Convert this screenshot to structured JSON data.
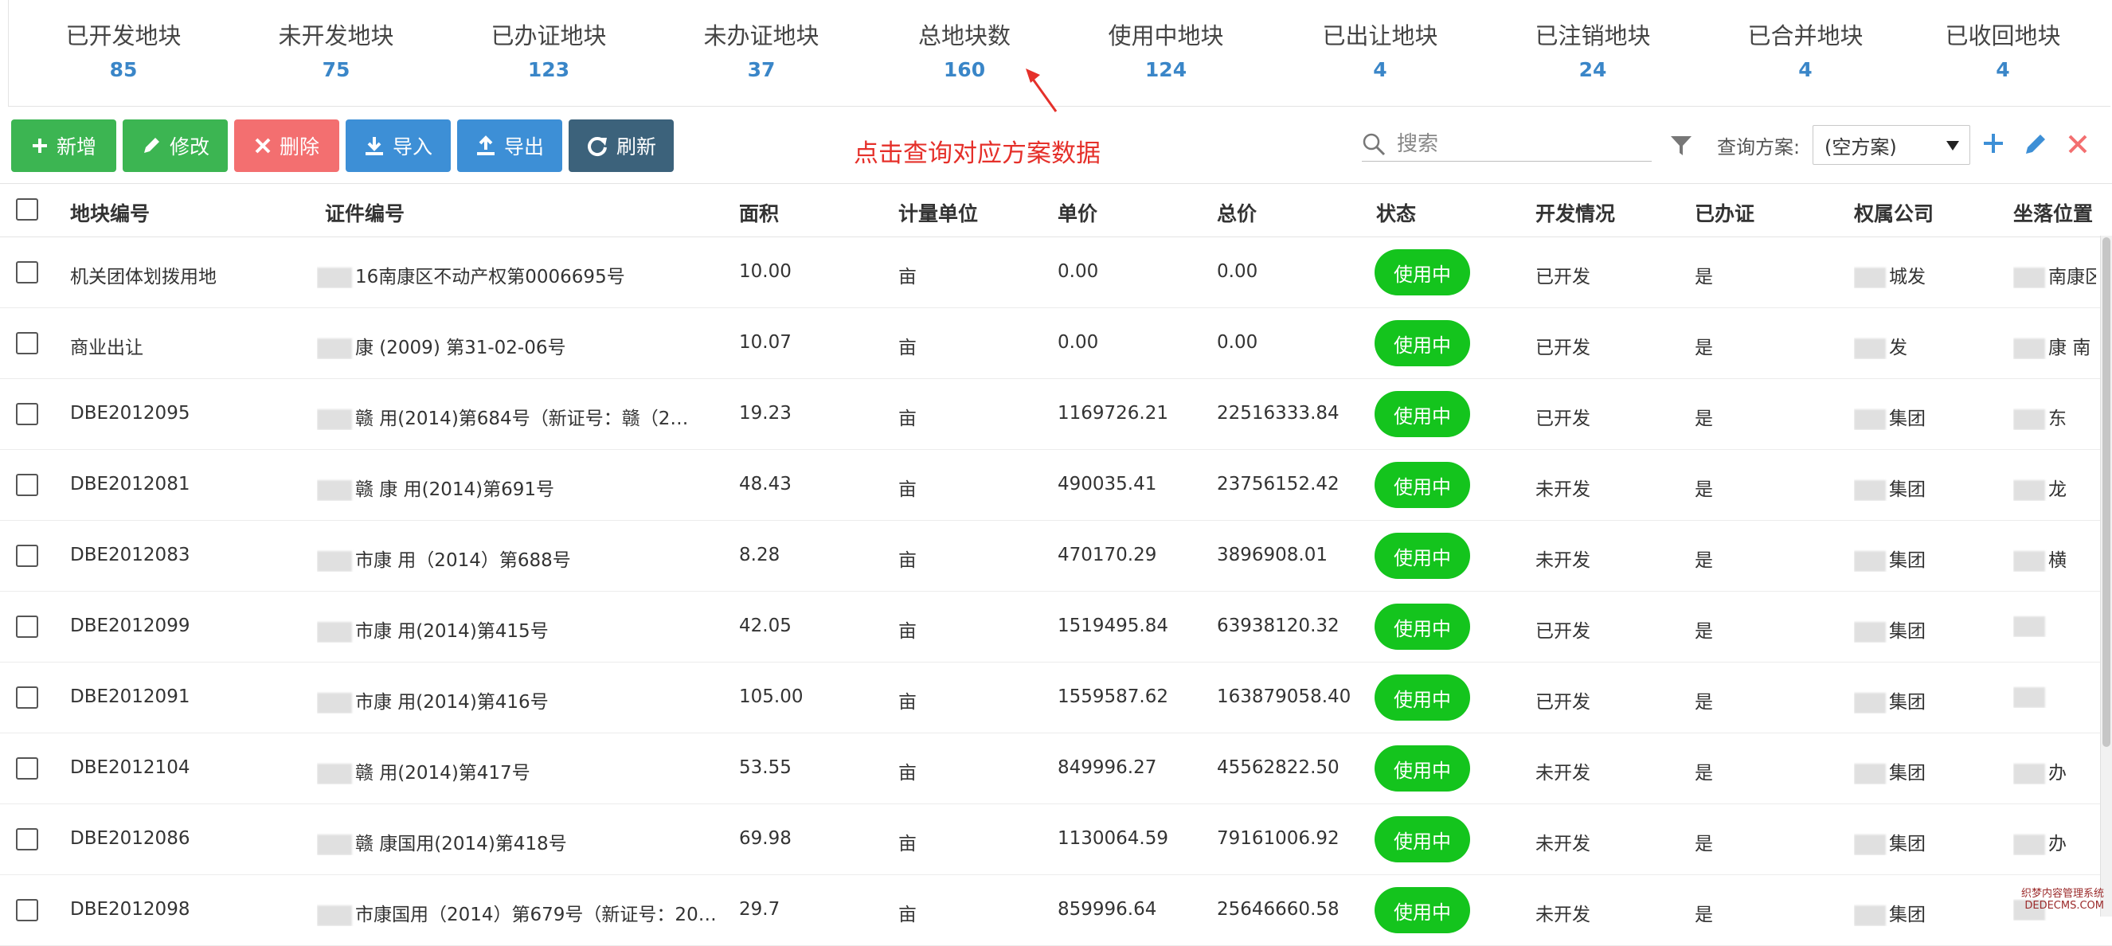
{
  "stats": [
    {
      "label": "已开发地块",
      "value": "85"
    },
    {
      "label": "未开发地块",
      "value": "75"
    },
    {
      "label": "已办证地块",
      "value": "123"
    },
    {
      "label": "未办证地块",
      "value": "37"
    },
    {
      "label": "总地块数",
      "value": "160"
    },
    {
      "label": "使用中地块",
      "value": "124"
    },
    {
      "label": "已出让地块",
      "value": "4"
    },
    {
      "label": "已注销地块",
      "value": "24"
    },
    {
      "label": "已合并地块",
      "value": "4"
    },
    {
      "label": "已收回地块",
      "value": "4"
    }
  ],
  "hint": "点击查询对应方案数据",
  "toolbar": {
    "add": "新增",
    "edit": "修改",
    "delete": "删除",
    "import": "导入",
    "export": "导出",
    "refresh": "刷新"
  },
  "search": {
    "placeholder": "搜索"
  },
  "scheme": {
    "label": "查询方案:",
    "value": "(空方案)"
  },
  "columns": [
    "地块编号",
    "证件编号",
    "面积",
    "计量单位",
    "单价",
    "总价",
    "状态",
    "开发情况",
    "已办证",
    "权属公司",
    "坐落位置"
  ],
  "rows": [
    {
      "code": "机关团体划拨用地",
      "cert": "16南康区不动产权第0006695号",
      "area": "10.00",
      "unit": "亩",
      "price": "0.00",
      "total": "0.00",
      "status": "使用中",
      "dev": "已开发",
      "cert_done": "是",
      "company": "城发",
      "location": "南康区东山"
    },
    {
      "code": "商业出让",
      "cert": "康 (2009) 第31-02-06号",
      "area": "10.07",
      "unit": "亩",
      "price": "0.00",
      "total": "0.00",
      "status": "使用中",
      "dev": "已开发",
      "cert_done": "是",
      "company": "发",
      "location": "康 南"
    },
    {
      "code": "DBE2012095",
      "cert": "赣 用(2014)第684号（新证号：赣（2…",
      "area": "19.23",
      "unit": "亩",
      "price": "1169726.21",
      "total": "22516333.84",
      "status": "使用中",
      "dev": "已开发",
      "cert_done": "是",
      "company": "集团",
      "location": "东"
    },
    {
      "code": "DBE2012081",
      "cert": "赣 康 用(2014)第691号",
      "area": "48.43",
      "unit": "亩",
      "price": "490035.41",
      "total": "23756152.42",
      "status": "使用中",
      "dev": "未开发",
      "cert_done": "是",
      "company": "集团",
      "location": "龙"
    },
    {
      "code": "DBE2012083",
      "cert": "市康 用（2014）第688号",
      "area": "8.28",
      "unit": "亩",
      "price": "470170.29",
      "total": "3896908.01",
      "status": "使用中",
      "dev": "未开发",
      "cert_done": "是",
      "company": "集团",
      "location": "横"
    },
    {
      "code": "DBE2012099",
      "cert": "市康 用(2014)第415号",
      "area": "42.05",
      "unit": "亩",
      "price": "1519495.84",
      "total": "63938120.32",
      "status": "使用中",
      "dev": "已开发",
      "cert_done": "是",
      "company": "集团",
      "location": ""
    },
    {
      "code": "DBE2012091",
      "cert": "市康 用(2014)第416号",
      "area": "105.00",
      "unit": "亩",
      "price": "1559587.62",
      "total": "163879058.40",
      "status": "使用中",
      "dev": "已开发",
      "cert_done": "是",
      "company": "集团",
      "location": ""
    },
    {
      "code": "DBE2012104",
      "cert": "赣 用(2014)第417号",
      "area": "53.55",
      "unit": "亩",
      "price": "849996.27",
      "total": "45562822.50",
      "status": "使用中",
      "dev": "未开发",
      "cert_done": "是",
      "company": "集团",
      "location": "办"
    },
    {
      "code": "DBE2012086",
      "cert": "赣 康国用(2014)第418号",
      "area": "69.98",
      "unit": "亩",
      "price": "1130064.59",
      "total": "79161006.92",
      "status": "使用中",
      "dev": "未开发",
      "cert_done": "是",
      "company": "集团",
      "location": "办"
    },
    {
      "code": "DBE2012098",
      "cert": "市康国用（2014）第679号（新证号：20…",
      "area": "29.7",
      "unit": "亩",
      "price": "859996.64",
      "total": "25646660.58",
      "status": "使用中",
      "dev": "未开发",
      "cert_done": "是",
      "company": "集团",
      "location": ""
    }
  ],
  "watermark": {
    "line1": "织梦内容管理系统",
    "line2": "DEDECMS.COM"
  },
  "colors": {
    "green": "#3cb552",
    "red": "#f36f70",
    "blue": "#3d8fd6",
    "dark": "#3c627b",
    "badge": "#14c41d",
    "stat_value": "#3a86c8",
    "hint": "#e5302a"
  }
}
